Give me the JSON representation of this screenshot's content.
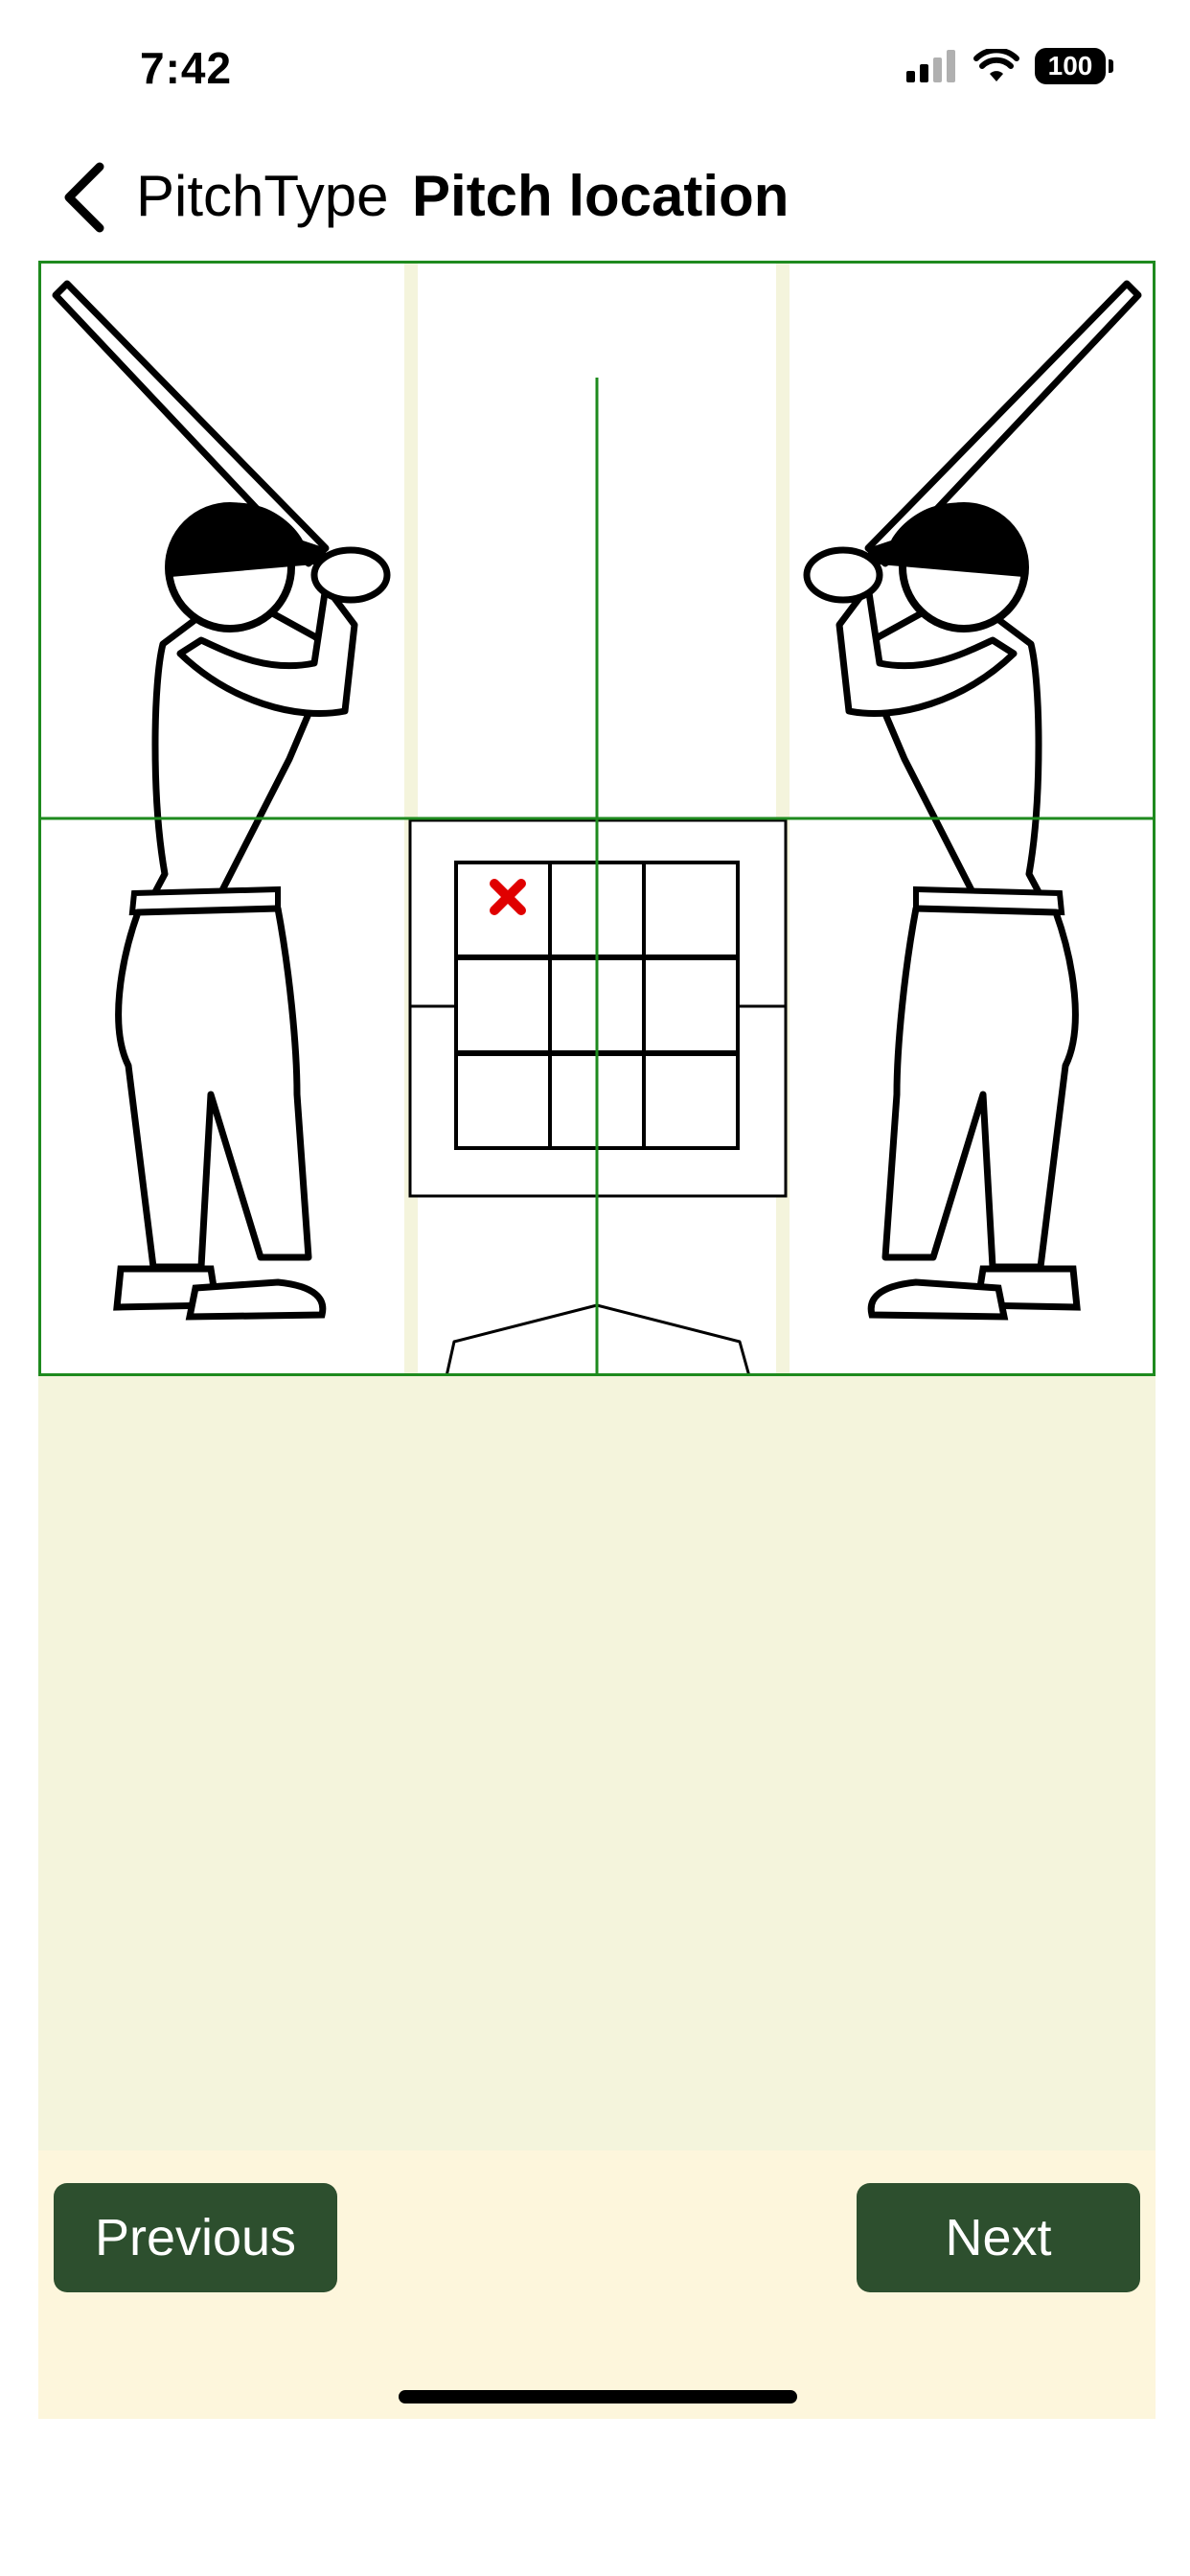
{
  "status_bar": {
    "time": "7:42",
    "battery_level": "100",
    "icons": [
      "cellular-signal-icon",
      "wifi-icon",
      "battery-icon"
    ]
  },
  "nav": {
    "back_label": "PitchType",
    "title": "Pitch location",
    "back_icon": "chevron-left-icon"
  },
  "pitch_location": {
    "strike_zone_rows": 3,
    "strike_zone_cols": 3,
    "selected_zone": {
      "row": 1,
      "col": 1
    },
    "marker_icon": "x-mark-icon",
    "marker_color": "#e00000"
  },
  "buttons": {
    "previous": "Previous",
    "next": "Next"
  },
  "colors": {
    "button_bg": "#2d4f2e",
    "grid_line": "#1e8a1e",
    "content_bg": "#f4f4dc",
    "bottom_bg": "#fdf6dc"
  }
}
